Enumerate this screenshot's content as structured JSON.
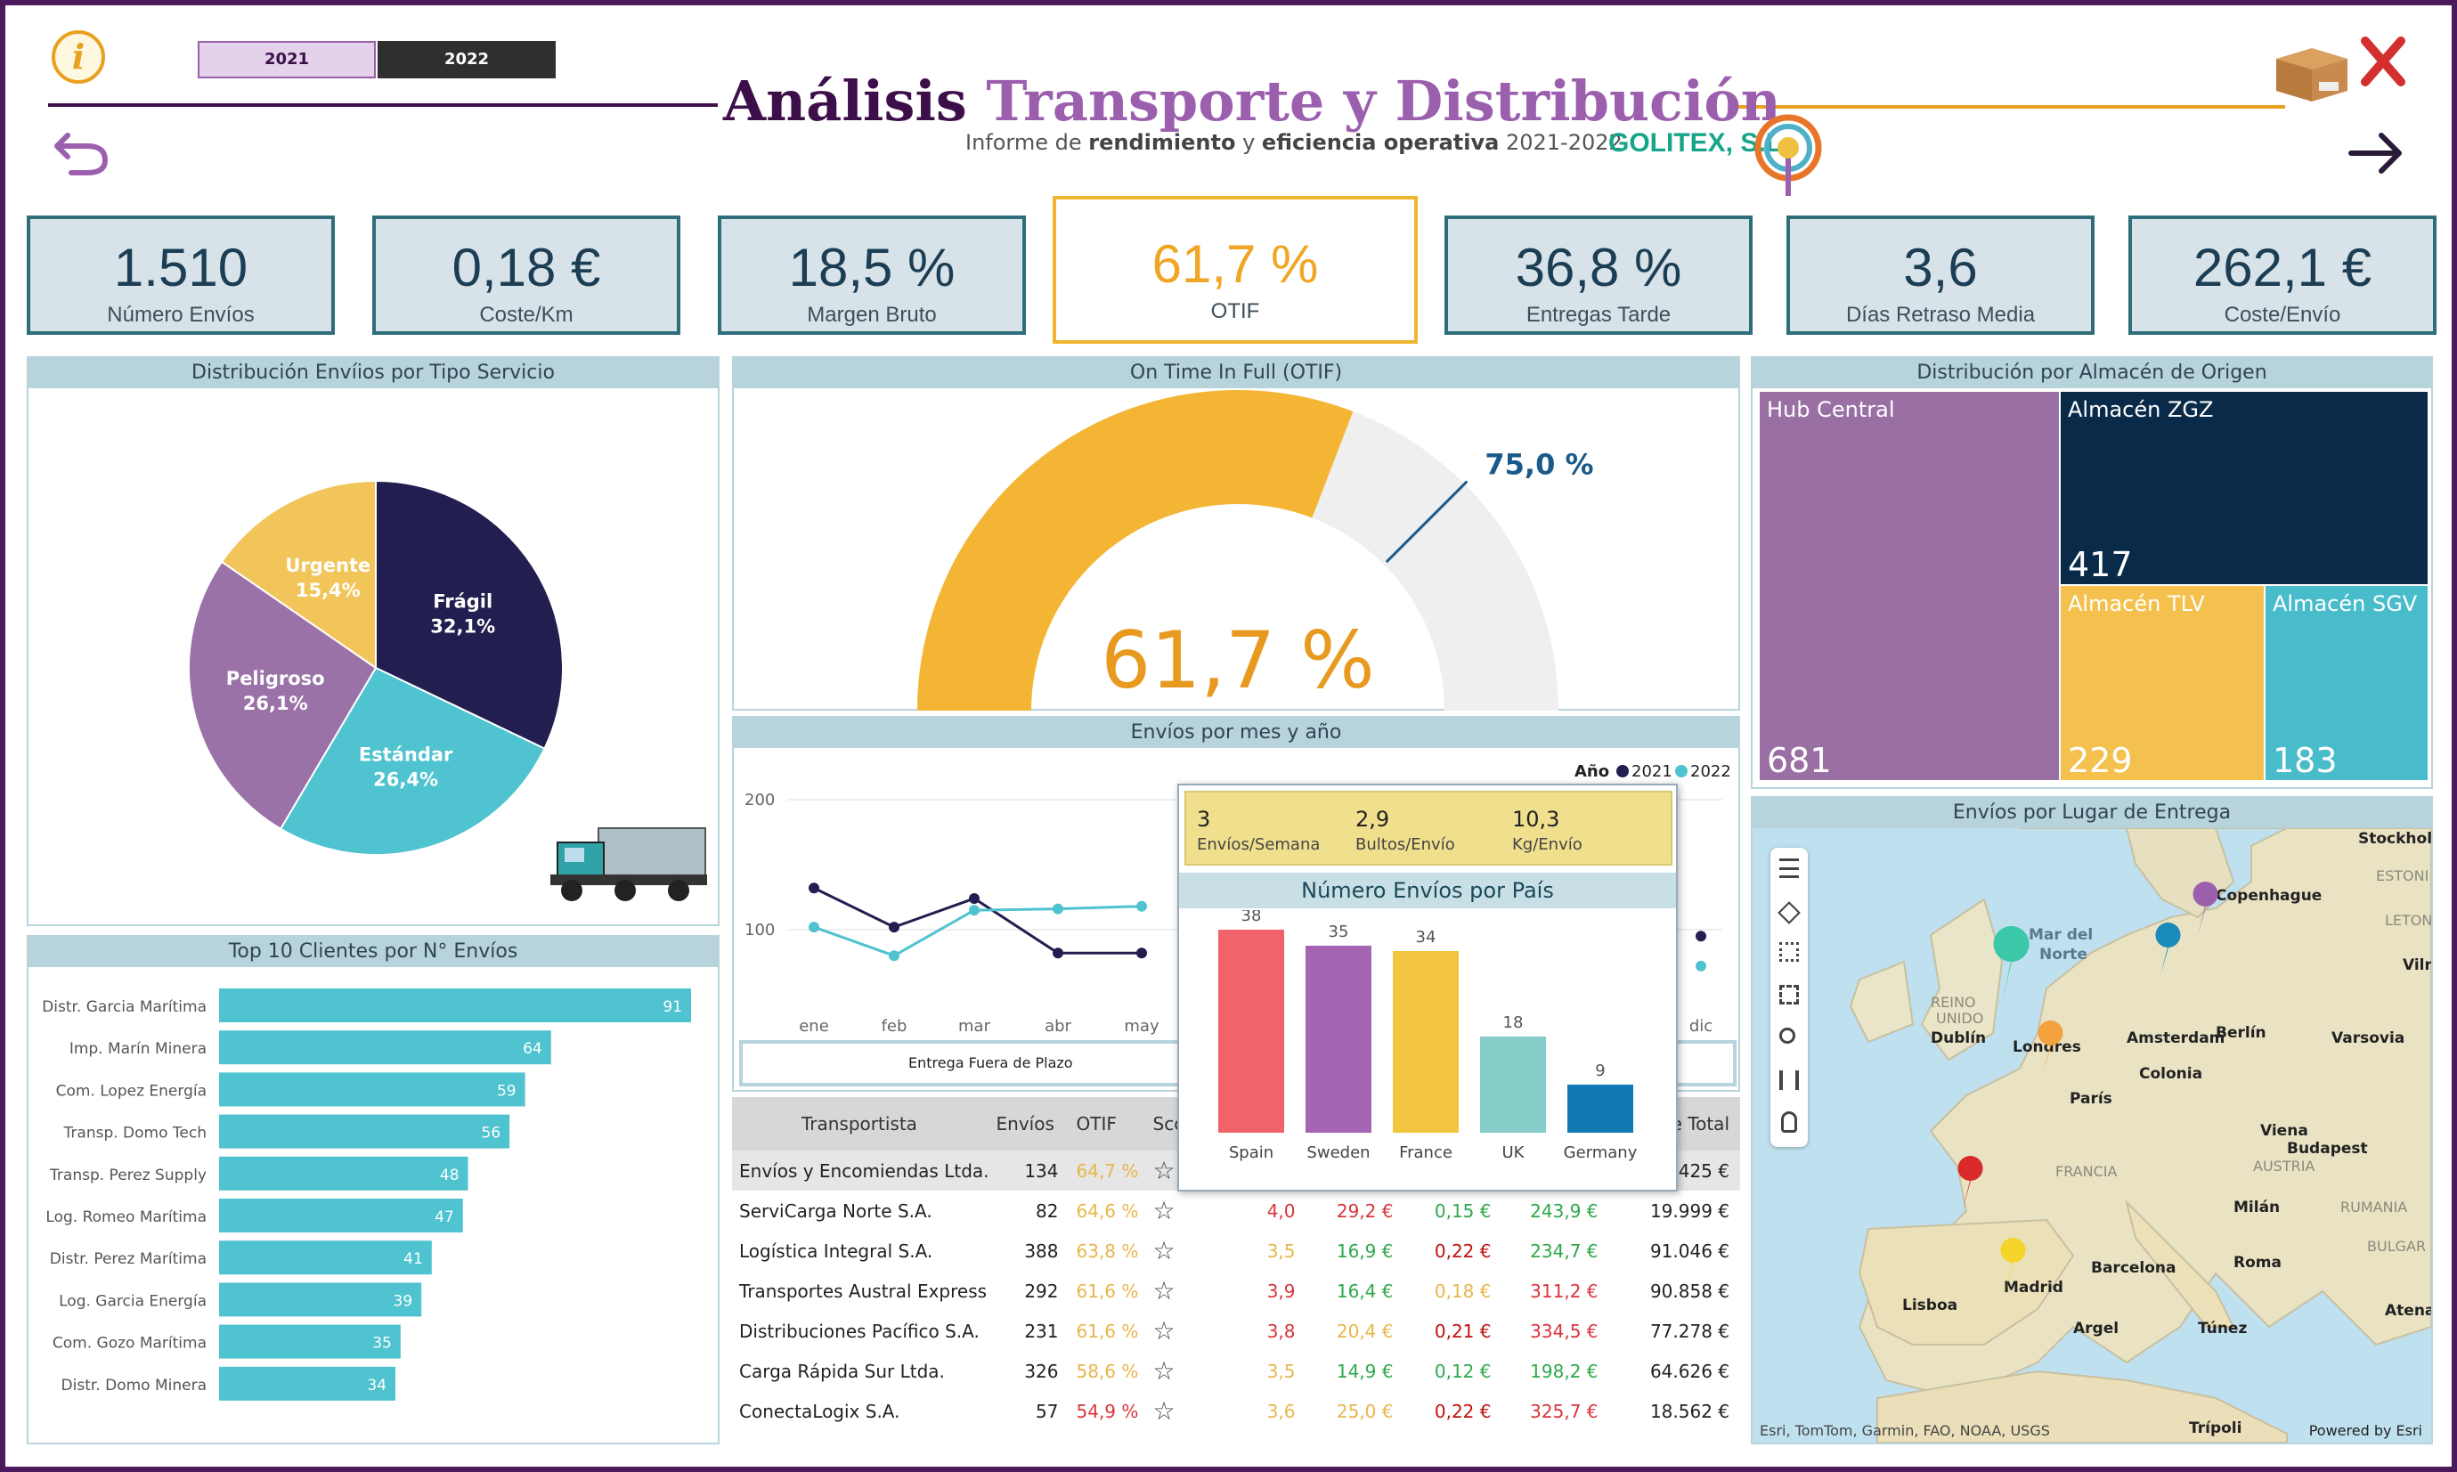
{
  "header": {
    "title_part1": "Análisis",
    "title_part2": "Transporte y Distribución",
    "subtitle_pre": "Informe de ",
    "subtitle_b1": "rendimiento",
    "subtitle_mid": " y ",
    "subtitle_b2": "eficiencia operativa",
    "subtitle_post": " 2021-2022",
    "brand": "GOLITEX, S.L.",
    "year_2021": "2021",
    "year_2022": "2022",
    "info_icon": "info-icon",
    "colors": {
      "dark": "#3d0f4a",
      "purple": "#9b5fae",
      "orange": "#e8a020"
    }
  },
  "kpis": [
    {
      "value": "1.510",
      "label": "Número Envíos"
    },
    {
      "value": "0,18 €",
      "label": "Coste/Km"
    },
    {
      "value": "18,5 %",
      "label": "Margen Bruto"
    },
    {
      "value": "61,7 %",
      "label": "OTIF"
    },
    {
      "value": "36,8 %",
      "label": "Entregas Tarde"
    },
    {
      "value": "3,6",
      "label": "Días Retraso Media"
    },
    {
      "value": "262,1 €",
      "label": "Coste/Envío"
    }
  ],
  "pie": {
    "title": "Distribución Envíios por Tipo Servicio",
    "slices": [
      {
        "name": "Frágil",
        "pct": "32,1%",
        "value": 32.1,
        "color": "#221e50"
      },
      {
        "name": "Estándar",
        "pct": "26,4%",
        "value": 26.4,
        "color": "#4fc3cf"
      },
      {
        "name": "Peligroso",
        "pct": "26,1%",
        "value": 26.1,
        "color": "#9a72a8"
      },
      {
        "name": "Urgente",
        "pct": "15,4%",
        "value": 15.4,
        "color": "#f2c55a"
      }
    ]
  },
  "gauge": {
    "title": "On Time In Full (OTIF)",
    "value": "61,7 %",
    "value_num": 61.7,
    "target": "75,0 %",
    "target_num": 75.0,
    "colors": {
      "fill": "#f4b534",
      "track": "#efefef",
      "target": "#1a5a8a"
    }
  },
  "linechart": {
    "title": "Envíos por mes y año",
    "legend_title": "Año",
    "y_ticks": [
      "200",
      "100"
    ],
    "months": [
      "ene",
      "feb",
      "mar",
      "abr",
      "may",
      "dic"
    ],
    "series": [
      {
        "name": "2021",
        "color": "#221e50",
        "values": [
          132,
          102,
          124,
          82,
          82
        ]
      },
      {
        "name": "2022",
        "color": "#4fc3cf",
        "values": [
          102,
          80,
          115,
          116,
          118
        ]
      }
    ],
    "dec_values": [
      {
        "series": "2021",
        "value": 95
      },
      {
        "series": "2022",
        "value": 72
      }
    ],
    "button": "Entrega Fuera de Plazo"
  },
  "tooltip": {
    "metrics": [
      {
        "value": "3",
        "label": "Envíos/Semana"
      },
      {
        "value": "2,9",
        "label": "Bultos/Envío"
      },
      {
        "value": "10,3",
        "label": "Kg/Envío"
      }
    ],
    "chart_title": "Número Envíos por País",
    "chart_data": {
      "type": "bar",
      "title": "Número Envíos por País",
      "categories": [
        "Spain",
        "Sweden",
        "France",
        "UK",
        "Germany"
      ],
      "values": [
        38,
        35,
        34,
        18,
        9
      ],
      "colors": [
        "#f0636a",
        "#a466b4",
        "#f2c440",
        "#86cdca",
        "#1179b4"
      ]
    }
  },
  "treemap": {
    "title": "Distribución por Almacén de Origen",
    "items": [
      {
        "name": "Hub Central",
        "value": "681",
        "color": "#9a70a4"
      },
      {
        "name": "Almacén ZGZ",
        "value": "417",
        "color": "#0a2a4a"
      },
      {
        "name": "Almacén TLV",
        "value": "229",
        "color": "#f4c14e"
      },
      {
        "name": "Almacén SGV",
        "value": "183",
        "color": "#49bccb"
      }
    ]
  },
  "map": {
    "title": "Envíos por Lugar de Entrega",
    "labels": [
      "Mar del",
      "Norte",
      "REINO",
      "UNIDO",
      "Dublín",
      "Londres",
      "Amsterdam",
      "Berlín",
      "Varsovia",
      "Colonia",
      "París",
      "Viena",
      "Budapest",
      "AUSTRIA",
      "FRANCIA",
      "Milán",
      "RUMANIA",
      "BULGAR",
      "Roma",
      "Barcelona",
      "Madrid",
      "Lisboa",
      "Argel",
      "Túnez",
      "Atenas",
      "Copenhague",
      "Stockholm",
      "ESTONI",
      "LETON",
      "Viln",
      "Trípoli"
    ],
    "attribution": "Esri, TomTom, Garmin, FAO, NOAA, USGS",
    "powered": "Powered by Esri"
  },
  "top10": {
    "title": "Top 10 Clientes por N° Envíos",
    "chart_data": {
      "type": "bar",
      "title": "Top 10 Clientes por N° Envíos",
      "categories": [
        "Distr. Garcia Marítima",
        "Imp. Marín Minera",
        "Com. Lopez Energía",
        "Transp. Domo Tech",
        "Transp. Perez Supply",
        "Log. Romeo Marítima",
        "Distr. Perez Marítima",
        "Log. Garcia Energía",
        "Com. Gozo Marítima",
        "Distr. Domo Minera"
      ],
      "values": [
        91,
        64,
        59,
        56,
        48,
        47,
        41,
        39,
        35,
        34
      ],
      "color": "#4fc3cf"
    }
  },
  "table": {
    "headers": [
      "Transportista",
      "Envíos",
      "OTIF",
      "Sco",
      "",
      "",
      "",
      "",
      "e Total"
    ],
    "rows": [
      {
        "name": "Envíos y Encomiendas Ltda.",
        "envios": "134",
        "otif": "64,7 %",
        "c1": "",
        "c2": "",
        "c3": "",
        "c4": "",
        "total": "425 €",
        "otif_color": "#e8b64a"
      },
      {
        "name": "ServiCarga Norte S.A.",
        "envios": "82",
        "otif": "64,6 %",
        "c1": "4,0",
        "c2": "29,2 €",
        "c3": "0,15 €",
        "c4": "243,9 €",
        "total": "19.999 €",
        "otif_color": "#e8b64a"
      },
      {
        "name": "Logística Integral S.A.",
        "envios": "388",
        "otif": "63,8 %",
        "c1": "3,5",
        "c2": "16,9 €",
        "c3": "0,22 €",
        "c4": "234,7 €",
        "total": "91.046 €",
        "otif_color": "#e8b64a"
      },
      {
        "name": "Transportes Austral Express",
        "envios": "292",
        "otif": "61,6 %",
        "c1": "3,9",
        "c2": "16,4 €",
        "c3": "0,18 €",
        "c4": "311,2 €",
        "total": "90.858 €",
        "otif_color": "#e8b64a"
      },
      {
        "name": "Distribuciones Pacífico S.A.",
        "envios": "231",
        "otif": "61,6 %",
        "c1": "3,8",
        "c2": "20,4 €",
        "c3": "0,21 €",
        "c4": "334,5 €",
        "total": "77.278 €",
        "otif_color": "#e8b64a"
      },
      {
        "name": "Carga Rápida Sur Ltda.",
        "envios": "326",
        "otif": "58,6 %",
        "c1": "3,5",
        "c2": "14,9 €",
        "c3": "0,12 €",
        "c4": "198,2 €",
        "total": "64.626 €",
        "otif_color": "#e8b64a"
      },
      {
        "name": "ConectaLogix S.A.",
        "envios": "57",
        "otif": "54,9 %",
        "c1": "3,6",
        "c2": "25,0 €",
        "c3": "0,22 €",
        "c4": "325,7 €",
        "total": "18.562 €",
        "otif_color": "#d8343a"
      }
    ],
    "cell_colors": {
      "c1": [
        "",
        "#d8343a",
        "#e8b64a",
        "#d8343a",
        "#d8343a",
        "#e8b64a",
        "#e8b64a"
      ],
      "c2": [
        "",
        "#d8343a",
        "#2ea84a",
        "#2ea84a",
        "#e8b64a",
        "#2ea84a",
        "#e8b64a"
      ],
      "c3": [
        "",
        "#2ea84a",
        "#c01010",
        "#e8b64a",
        "#c01010",
        "#2ea84a",
        "#c01010"
      ],
      "c4": [
        "",
        "#2ea84a",
        "#2ea84a",
        "#d8343a",
        "#d8343a",
        "#2ea84a",
        "#d8343a"
      ]
    }
  }
}
